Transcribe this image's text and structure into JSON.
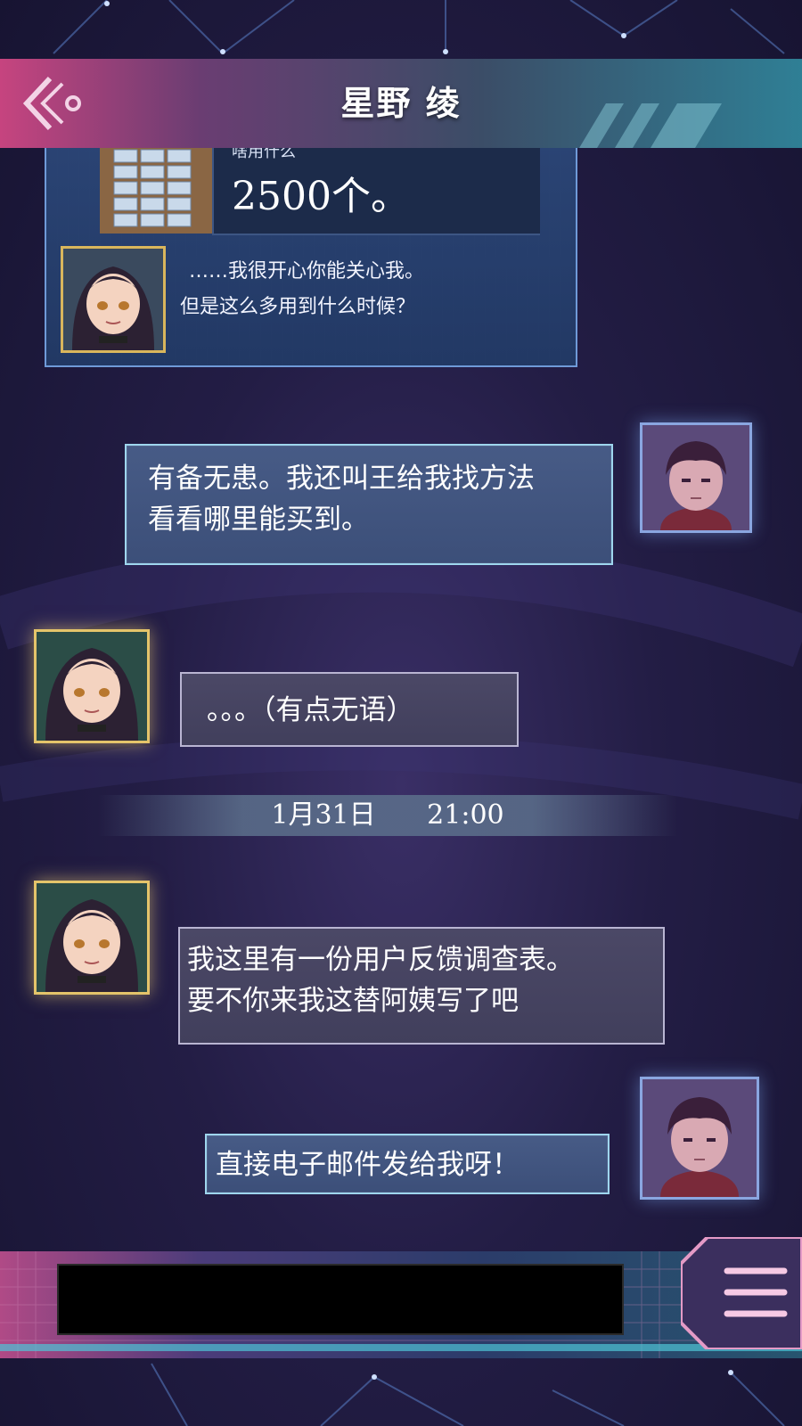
{
  "header": {
    "title": "星野 绫",
    "back_label": "back"
  },
  "quoted_message": {
    "cut_text": "啥用什么",
    "text": "2500个。"
  },
  "messages": [
    {
      "sender": "girl",
      "lines": [
        "……我很开心你能关心我。",
        "但是这么多用到什么时候？"
      ]
    },
    {
      "sender": "boy",
      "lines": [
        "有备无患。我还叫王给我找方法",
        "看看哪里能买到。"
      ]
    },
    {
      "sender": "girl",
      "lines": [
        "。。。（有点无语）"
      ]
    },
    {
      "sender": "girl",
      "lines": [
        "我这里有一份用户反馈调查表。",
        "要不你来我这替阿姨写了吧"
      ]
    },
    {
      "sender": "boy",
      "lines": [
        "直接电子邮件发给我呀！"
      ]
    }
  ],
  "timestamp": {
    "date": "1月31日",
    "time": "21:00"
  },
  "icons": {
    "back": "back-chevron-icon",
    "menu": "menu-lines-icon"
  },
  "colors": {
    "header_left": "#c6447f",
    "header_right": "#2f7f95",
    "bubble_blue_border": "#9ed6ee",
    "girl_frame": "#e4c46a",
    "boy_frame": "#8aa6e0"
  }
}
